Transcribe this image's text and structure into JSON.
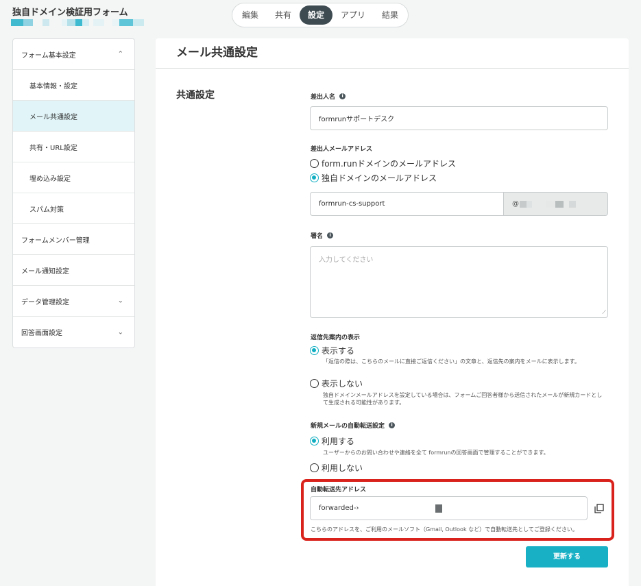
{
  "app": {
    "title": "独自ドメイン検証用フォーム"
  },
  "colors": {
    "accent": "#11aec2",
    "tab_active_bg": "#3e4b51",
    "highlight": "#d9221b",
    "sidebar_active": "#e1f5f8"
  },
  "tabs": [
    {
      "label": "編集",
      "active": false
    },
    {
      "label": "共有",
      "active": false
    },
    {
      "label": "設定",
      "active": true
    },
    {
      "label": "アプリ",
      "active": false
    },
    {
      "label": "結果",
      "active": false
    }
  ],
  "sidebar": {
    "items": [
      {
        "label": "フォーム基本設定",
        "icon": "chevron-up-icon",
        "chev": "⌃"
      },
      {
        "label": "基本情報・設定"
      },
      {
        "label": "メール共通設定",
        "active": true
      },
      {
        "label": "共有・URL設定"
      },
      {
        "label": "埋め込み設定"
      },
      {
        "label": "スパム対策"
      },
      {
        "label": "フォームメンバー管理"
      },
      {
        "label": "メール通知設定"
      },
      {
        "label": "データ管理設定",
        "icon": "chevron-down-icon",
        "chev": "⌄"
      },
      {
        "label": "回答画面設定",
        "icon": "chevron-down-icon",
        "chev": "⌄"
      }
    ]
  },
  "page": {
    "heading": "メール共通設定",
    "section_title": "共通設定"
  },
  "sender_name": {
    "label": "差出人名",
    "value": "formrunサポートデスク"
  },
  "sender_email": {
    "label": "差出人メールアドレス",
    "option_formrun": "form.runドメインのメールアドレス",
    "option_custom": "独自ドメインのメールアドレス",
    "local_part": "formrun-cs-support",
    "domain_prefix": "@"
  },
  "signature": {
    "label": "署名",
    "placeholder": "入力してください"
  },
  "reply_display": {
    "label": "返信先案内の表示",
    "option_show": "表示する",
    "show_help": "「返信の際は、こちらのメールに直接ご返信ください」の文章と、返信先の案内をメールに表示します。",
    "option_hide": "表示しない",
    "hide_help": "独自ドメインメールアドレスを設定している場合は、フォームご回答者様から送信されたメールが新規カードとして生成される可能性があります。"
  },
  "auto_forward": {
    "label": "新規メールの自動転送設定",
    "option_use": "利用する",
    "use_help": "ユーザーからのお問い合わせや連絡を全て formrunの回答画面で管理することができます。",
    "option_not_use": "利用しない"
  },
  "forward_address": {
    "label": "自動転送先アドレス",
    "value": "forwarded-",
    "help": "こちらのアドレスを、ご利用のメールソフト（Gmail, Outlook など）で自動転送先としてご登録ください。"
  },
  "actions": {
    "update_label": "更新する"
  }
}
